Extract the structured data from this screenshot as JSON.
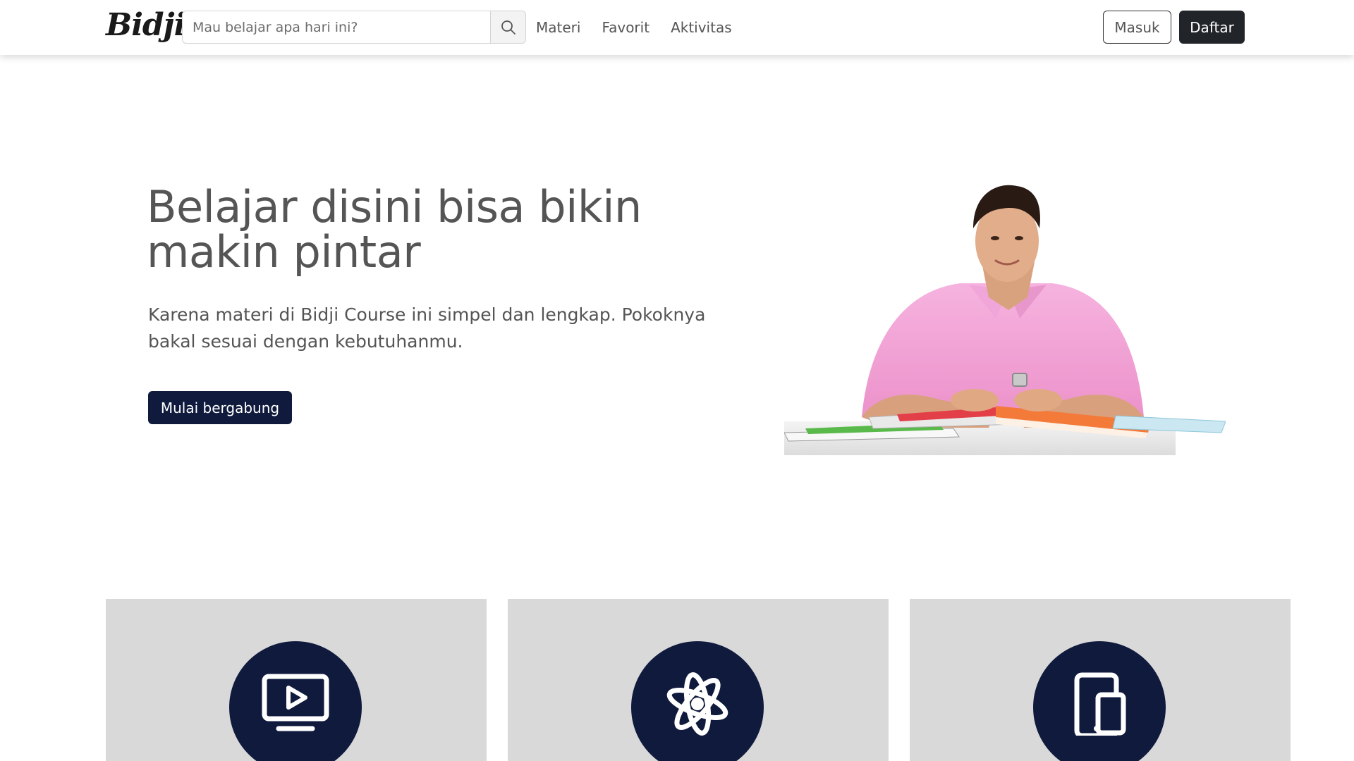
{
  "navbar": {
    "brand": "Bidji",
    "search": {
      "placeholder": "Mau belajar apa hari ini?",
      "value": "",
      "icon": "search-icon"
    },
    "links": [
      "Materi",
      "Favorit",
      "Aktivitas"
    ],
    "login_label": "Masuk",
    "register_label": "Daftar"
  },
  "hero": {
    "title": "Belajar disini bisa bikin makin pintar",
    "subtitle": "Karena materi di Bidji Course ini simpel dan lengkap. Pokoknya bakal sesuai dengan kebutuhanmu.",
    "cta_label": "Mulai bergabung"
  },
  "features": [
    {
      "icon": "video-icon"
    },
    {
      "icon": "atom-icon"
    },
    {
      "icon": "mobile-device-icon"
    }
  ],
  "colors": {
    "navy": "#0f1a3d",
    "dark": "#212529",
    "text": "#555555",
    "card_bg": "#d9d9d9",
    "shirt_pink": "#f2a0d4"
  }
}
